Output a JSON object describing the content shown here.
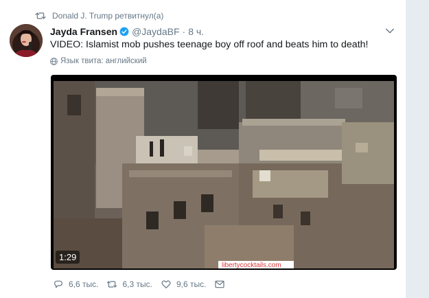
{
  "retweet_context": {
    "icon": "retweet-icon",
    "text": "Donald J. Trump ретвитнул(а)"
  },
  "tweet": {
    "fullname": "Jayda Fransen",
    "verified_icon": "verified-badge-icon",
    "username": "@JaydaBF",
    "separator": "·",
    "time": "8 ч.",
    "text": "VIDEO: Islamist mob pushes teenage boy off roof and beats him to death!",
    "translate_label": "Язык твита: английский",
    "media": {
      "duration": "1:29",
      "watermark": "libertycocktails.com"
    },
    "actions": {
      "reply_count": "6,6 тыс.",
      "retweet_count": "6,3 тыс.",
      "like_count": "9,6 тыс."
    }
  },
  "colors": {
    "secondary_text": "#657786",
    "link_blue": "#1da1f2",
    "rail": "#e6ecf0"
  }
}
